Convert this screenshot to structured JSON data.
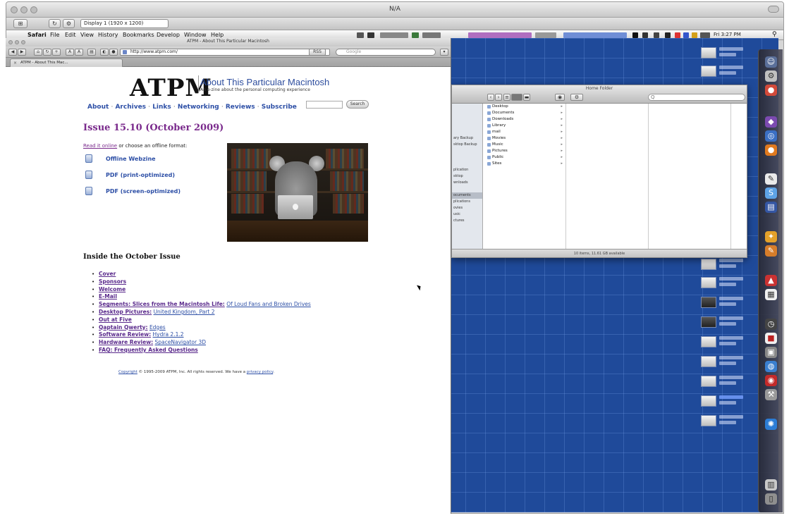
{
  "outer_window": {
    "title": "N/A"
  },
  "vnc_toolbar": {
    "display": "Display 1 (1920 x 1200)"
  },
  "menubar": {
    "app": "Safari",
    "items": [
      "File",
      "Edit",
      "View",
      "History",
      "Bookmarks",
      "Develop",
      "Window",
      "Help"
    ],
    "clock": "Fri 3:27 PM"
  },
  "safari": {
    "window_title": "ATPM - About This Particular Macintosh",
    "address": "http://www.atpm.com/",
    "search_placeholder": "Google",
    "tab_title": "ATPM - About This Mac..."
  },
  "page": {
    "logo": "ATPM",
    "site_title": "About This Particular Macintosh",
    "tagline": "An e-zine about the personal computing experience",
    "nav": [
      "About",
      "Archives",
      "Links",
      "Networking",
      "Reviews",
      "Subscribe"
    ],
    "nav_separator": "·",
    "search_button": "Search",
    "issue_title": "Issue 15.10 (October 2009)",
    "read_online": "Read it online",
    "read_rest": " or choose an offline format:",
    "formats": [
      "Offline Webzine",
      "PDF (print-optimized)",
      "PDF (screen-optimized)"
    ],
    "inside_heading": "Inside the October Issue",
    "issue_items": [
      {
        "title": "Cover",
        "sub": ""
      },
      {
        "title": "Sponsors",
        "sub": ""
      },
      {
        "title": "Welcome",
        "sub": ""
      },
      {
        "title": "E-Mail",
        "sub": ""
      },
      {
        "title": "Segments: Slices from the Macintosh Life:",
        "sub": "Of Loud Fans and Broken Drives"
      },
      {
        "title": "Desktop Pictures:",
        "sub": "United Kingdom, Part 2"
      },
      {
        "title": "Out at Five",
        "sub": ""
      },
      {
        "title": "Qaptain Qwerty:",
        "sub": "Edges"
      },
      {
        "title": "Software Review:",
        "sub": "Hydra 2.1.2"
      },
      {
        "title": "Hardware Review:",
        "sub": "SpaceNavigator 3D"
      },
      {
        "title": "FAQ: Frequently Asked Questions",
        "sub": ""
      }
    ],
    "copyright_prefix": "Copyright",
    "copyright_text": " © 1995-2009 ATPM, Inc. All rights reserved. We have a ",
    "privacy_link": "privacy policy",
    "copyright_end": "."
  },
  "finder": {
    "title": "Home Folder",
    "search_placeholder": "Q",
    "sidebar": [
      "",
      "",
      "",
      "",
      "",
      "ary Backup",
      "sktop Backup",
      "",
      "",
      "",
      "plication",
      "sktop",
      "wnloads",
      "",
      "ocuments",
      "plications",
      "ovies",
      "usic",
      "ctures",
      "",
      "",
      ""
    ],
    "sidebar_selected": 14,
    "column1": [
      "Desktop",
      "Documents",
      "Downloads",
      "Library",
      "mail",
      "Movies",
      "Music",
      "Pictures",
      "Public",
      "Sites"
    ],
    "status": "10 items, 11.61 GB available"
  },
  "colors": {
    "desktop": "#1f4a9a",
    "link_blue": "#2d4fa6",
    "issue_purple": "#7a2a8c"
  }
}
